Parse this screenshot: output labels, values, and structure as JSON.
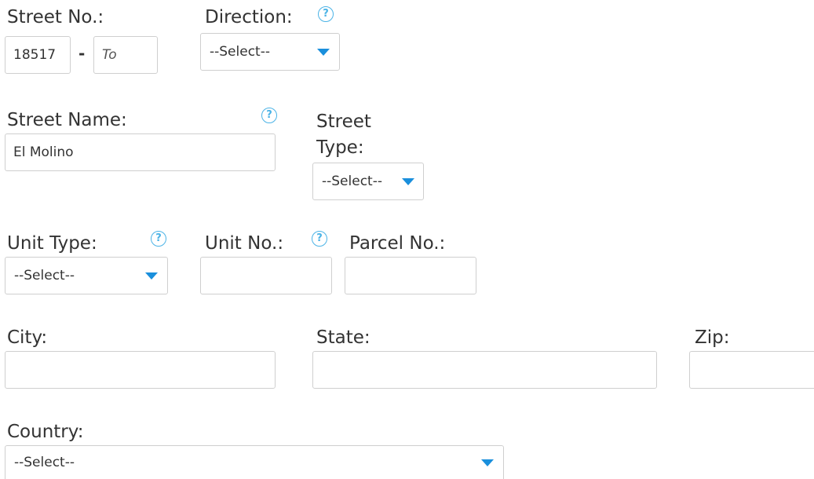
{
  "street_no": {
    "label": "Street No.:",
    "from_value": "18517",
    "separator": "-",
    "to_placeholder": "To"
  },
  "direction": {
    "label": "Direction:",
    "selected": "--Select--",
    "help_icon": "?"
  },
  "street_name": {
    "label": "Street Name:",
    "value": "El Molino",
    "help_icon": "?"
  },
  "street_type": {
    "label_line1": "Street",
    "label_line2": "Type:",
    "selected": "--Select--"
  },
  "unit_type": {
    "label": "Unit Type:",
    "selected": "--Select--",
    "help_icon": "?"
  },
  "unit_no": {
    "label": "Unit No.:",
    "value": "",
    "help_icon": "?"
  },
  "parcel_no": {
    "label": "Parcel No.:",
    "value": ""
  },
  "city": {
    "label": "City:",
    "value": ""
  },
  "state": {
    "label": "State:",
    "value": ""
  },
  "zip": {
    "label": "Zip:",
    "value": ""
  },
  "country": {
    "label": "Country:",
    "selected": "--Select--"
  },
  "icons": {
    "help": "question-circle-icon",
    "dropdown": "caret-down-icon"
  },
  "colors": {
    "accent": "#1a8fdc",
    "help": "#4bb3e6",
    "border": "#cfcfcf",
    "text": "#333333"
  }
}
